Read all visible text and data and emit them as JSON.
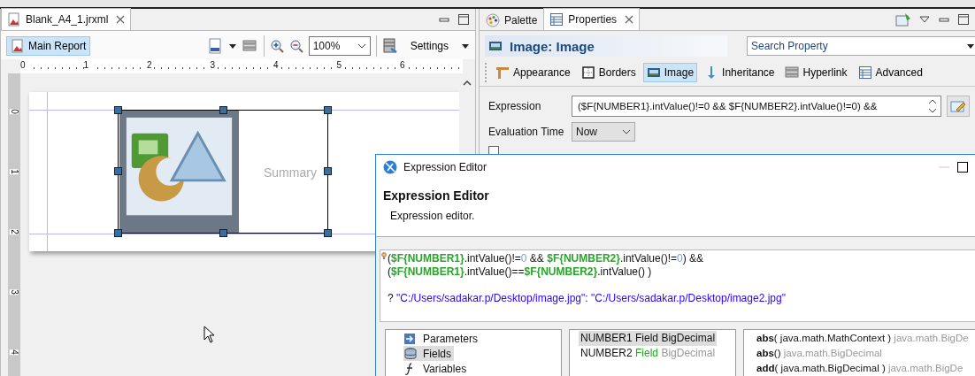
{
  "editor": {
    "tab": {
      "title": "Blank_A4_1.jrxml"
    },
    "breadcrumb": {
      "label": "Main Report",
      "selected": true
    },
    "zoom": "100%",
    "settings": "Settings",
    "ruler_marks": [
      "0",
      "1",
      "2",
      "3",
      "4",
      "5",
      "6"
    ],
    "vertical_ruler_marks": [
      "0",
      "1",
      "2",
      "3",
      "4"
    ],
    "band_label": "Summary"
  },
  "properties": {
    "tabs": [
      {
        "label": "Palette",
        "selected": false
      },
      {
        "label": "Properties",
        "selected": true
      }
    ],
    "title": "Image: Image",
    "search": {
      "placeholder": "Search Property"
    },
    "sections": [
      {
        "label": "Appearance",
        "selected": false
      },
      {
        "label": "Borders",
        "selected": false
      },
      {
        "label": "Image",
        "selected": true
      },
      {
        "label": "Inheritance",
        "selected": false
      },
      {
        "label": "Hyperlink",
        "selected": false
      },
      {
        "label": "Advanced",
        "selected": false
      }
    ],
    "expression": {
      "label": "Expression",
      "value": "($F{NUMBER1}.intValue()!=0 && $F{NUMBER2}.intValue()!=0) &&"
    },
    "evaluation_time": {
      "label": "Evaluation Time",
      "value": "Now"
    },
    "checkbox": {
      "checked": false
    }
  },
  "dialog": {
    "window_title": "Expression Editor",
    "heading": "Expression Editor",
    "description": "Expression editor.",
    "code_lines": [
      {
        "spaced": false,
        "segments": [
          {
            "kind": "plain",
            "text": "("
          },
          {
            "kind": "field",
            "text": "$F{NUMBER1}"
          },
          {
            "kind": "plain",
            "text": ".intValue()!="
          },
          {
            "kind": "number",
            "text": "0"
          },
          {
            "kind": "plain",
            "text": " && "
          },
          {
            "kind": "field",
            "text": "$F{NUMBER2}"
          },
          {
            "kind": "plain",
            "text": ".intValue()!="
          },
          {
            "kind": "number",
            "text": "0"
          },
          {
            "kind": "plain",
            "text": ") &&"
          }
        ]
      },
      {
        "spaced": false,
        "segments": [
          {
            "kind": "plain",
            "text": "("
          },
          {
            "kind": "field",
            "text": "$F{NUMBER1}"
          },
          {
            "kind": "plain",
            "text": ".intValue()=="
          },
          {
            "kind": "field",
            "text": "$F{NUMBER2}"
          },
          {
            "kind": "plain",
            "text": ".intValue() )"
          }
        ]
      },
      {
        "spaced": true,
        "segments": [
          {
            "kind": "plain",
            "text": "? "
          },
          {
            "kind": "string",
            "text": "\"C:/Users/sadakar.p/Desktop/image.jpg\""
          },
          {
            "kind": "plain",
            "text": ": "
          },
          {
            "kind": "string",
            "text": "\"C:/Users/sadakar.p/Desktop/image2.jpg\""
          }
        ]
      }
    ],
    "categories": [
      {
        "label": "Parameters",
        "selected": false
      },
      {
        "label": "Fields",
        "selected": true
      },
      {
        "label": "Variables",
        "selected": false
      }
    ],
    "fields": [
      {
        "name": "NUMBER1",
        "kind_label": "Field",
        "type": "BigDecimal",
        "selected": true
      },
      {
        "name": "NUMBER2",
        "kind_label": "Field",
        "type": "BigDecimal",
        "selected": false
      }
    ],
    "methods": [
      {
        "name": "abs",
        "params": "( java.math.MathContext )",
        "returns": "java.math.BigDe"
      },
      {
        "name": "abs",
        "params": "()",
        "returns": "java.math.BigDecimal"
      },
      {
        "name": "add",
        "params": "( java.math.BigDecimal )",
        "returns": "java.math.BigDe"
      }
    ]
  }
}
